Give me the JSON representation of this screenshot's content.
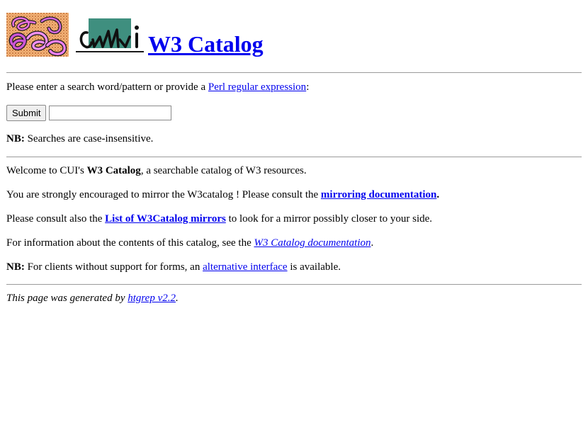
{
  "header": {
    "title": "W3 Catalog"
  },
  "search": {
    "prompt_before": "Please enter a search word/pattern or provide a ",
    "prompt_link": "Perl regular expression",
    "prompt_after": ":",
    "submit_label": "Submit",
    "input_value": "",
    "nb_label": "NB:",
    "nb_text": " Searches are case-insensitive."
  },
  "info": {
    "welcome_before": "Welcome to CUI's ",
    "welcome_bold": "W3 Catalog",
    "welcome_after": ", a searchable catalog of W3 resources.",
    "mirror_before": "You are strongly encouraged to mirror the W3catalog ! Please consult the ",
    "mirror_link": "mirroring documentation",
    "mirror_after": ".",
    "list_before": "Please consult also the ",
    "list_link": "List of W3Catalog mirrors",
    "list_after": " to look for a mirror possibly closer to your side.",
    "doc_before": "For information about the contents of this catalog, see the ",
    "doc_link": "W3 Catalog documentation",
    "doc_after": ".",
    "nb_label": "NB:",
    "alt_before": " For clients without support for forms, an ",
    "alt_link": "alternative interface",
    "alt_after": " is available."
  },
  "footer": {
    "text_before": "This page was generated by ",
    "link": "htgrep v2.2",
    "text_after": "."
  }
}
